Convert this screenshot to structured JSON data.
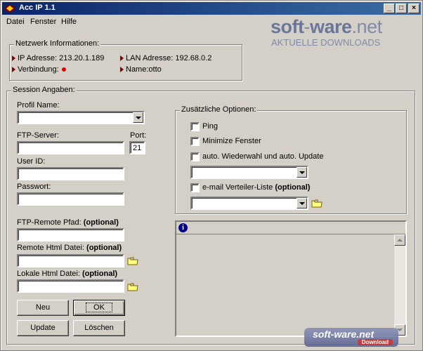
{
  "window": {
    "title": "Acc IP 1.1"
  },
  "menubar": {
    "items": [
      "Datei",
      "Fenster",
      "Hilfe"
    ]
  },
  "network": {
    "group_label": "Netzwerk Informationen:",
    "ip_label": "IP Adresse:",
    "ip_value": "213.20.1.189",
    "lan_label": "LAN Adresse:",
    "lan_value": "192.68.0.2",
    "connection_label": "Verbindung:",
    "connection_status_color": "#e00000",
    "name_label": "Name:",
    "name_value": "otto"
  },
  "session": {
    "group_label": "Session Angaben:",
    "profile_label": "Profil Name:",
    "profile_value": "",
    "ftp_server_label": "FTP-Server:",
    "ftp_server_value": "",
    "port_label": "Port:",
    "port_value": "21",
    "user_label": "User ID:",
    "user_value": "",
    "password_label": "Passwort:",
    "password_value": "",
    "remote_path_label": "FTP-Remote Pfad:",
    "remote_path_optional": "(optional)",
    "remote_html_label": "Remote Html Datei:",
    "remote_html_optional": "(optional)",
    "local_html_label": "Lokale Html Datei:",
    "local_html_optional": "(optional)"
  },
  "options": {
    "group_label": "Zusätzliche Optionen:",
    "ping": "Ping",
    "minimize": "Minimize Fenster",
    "auto_redial": "auto. Wiederwahl und auto. Update",
    "email_list": "e-mail Verteiler-Liste",
    "email_optional": "(optional)"
  },
  "buttons": {
    "new": "Neu",
    "ok": "OK",
    "update": "Update",
    "delete": "Löschen"
  },
  "info": {
    "icon": "info-icon"
  },
  "watermark": {
    "main_a": "soft",
    "main_sep": "-",
    "main_b": "ware",
    "main_c": ".net",
    "sub": "AKTUELLE DOWNLOADS",
    "badge": "soft-ware.net",
    "badge_sub": "Download"
  },
  "colors": {
    "titlebar": "#0a246a",
    "face": "#d4d0c8",
    "label_arrow": "#800000"
  }
}
